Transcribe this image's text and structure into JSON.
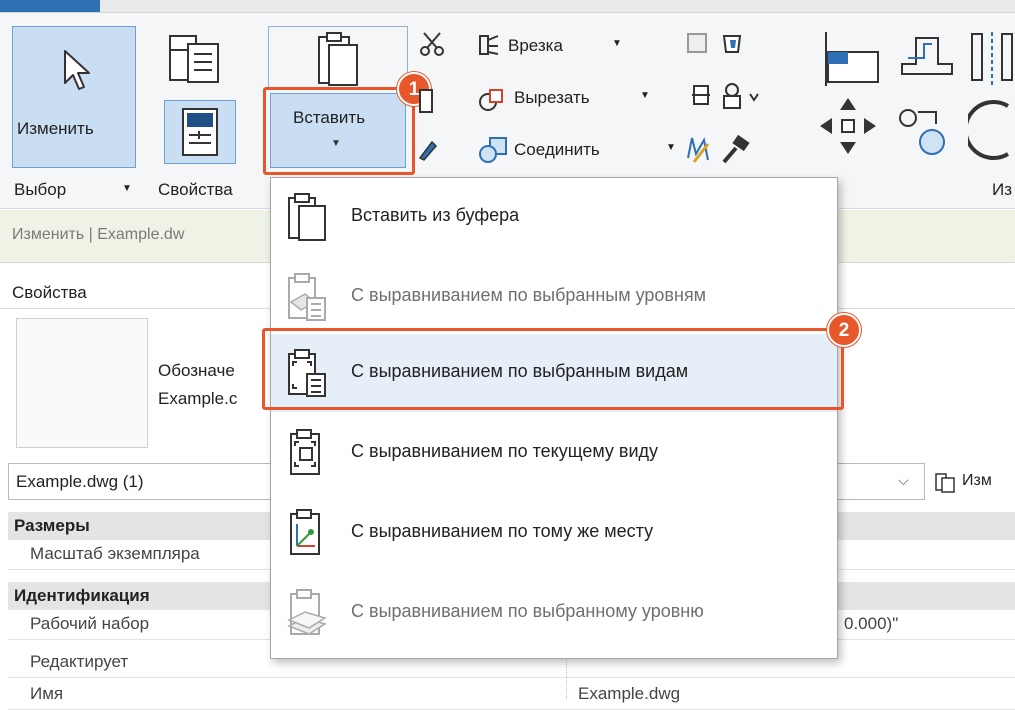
{
  "ribbon": {
    "modify_label": "Изменить",
    "select_label": "Выбор",
    "properties_label": "Свойства",
    "paste_label": "Вставить",
    "join_tools": {
      "cope": "Врезка",
      "cut": "Вырезать",
      "join": "Соединить"
    },
    "modify_panel_partial": "Из"
  },
  "context_bar": {
    "text": "Изменить | Example.dw"
  },
  "properties": {
    "title": "Свойства",
    "type_line1": "Обозначе",
    "type_line2": "Example.c",
    "selector_value": "Example.dwg (1)",
    "edit_type_partial": "Изм",
    "sections": [
      {
        "name": "Размеры",
        "rows": [
          {
            "key": "Масштаб экземпляра",
            "value": ""
          }
        ]
      },
      {
        "name": "Идентификация",
        "rows": [
          {
            "key": "Рабочий набор",
            "value": "0.000)\""
          },
          {
            "key": "Редактирует",
            "value": ""
          },
          {
            "key": "Имя",
            "value": "Example.dwg"
          }
        ]
      }
    ]
  },
  "paste_menu": {
    "items": [
      {
        "label": "Вставить из буфера",
        "enabled": true,
        "icon": "clipboard-icon"
      },
      {
        "label": "С выравниванием по выбранным уровням",
        "enabled": false,
        "icon": "paste-levels-icon"
      },
      {
        "label": "С выравниванием по выбранным видам",
        "enabled": true,
        "icon": "paste-views-icon",
        "highlighted": true
      },
      {
        "label": "С выравниванием по текущему виду",
        "enabled": true,
        "icon": "paste-current-view-icon"
      },
      {
        "label": "С выравниванием по тому же месту",
        "enabled": true,
        "icon": "paste-same-place-icon"
      },
      {
        "label": "С выравниванием по выбранному уровню",
        "enabled": false,
        "icon": "paste-level-icon"
      }
    ]
  },
  "callouts": {
    "step1": "1",
    "step2": "2"
  },
  "colors": {
    "accent": "#e8572a",
    "selected_button": "#c9ddf3",
    "context_bar": "#eef3e6"
  }
}
